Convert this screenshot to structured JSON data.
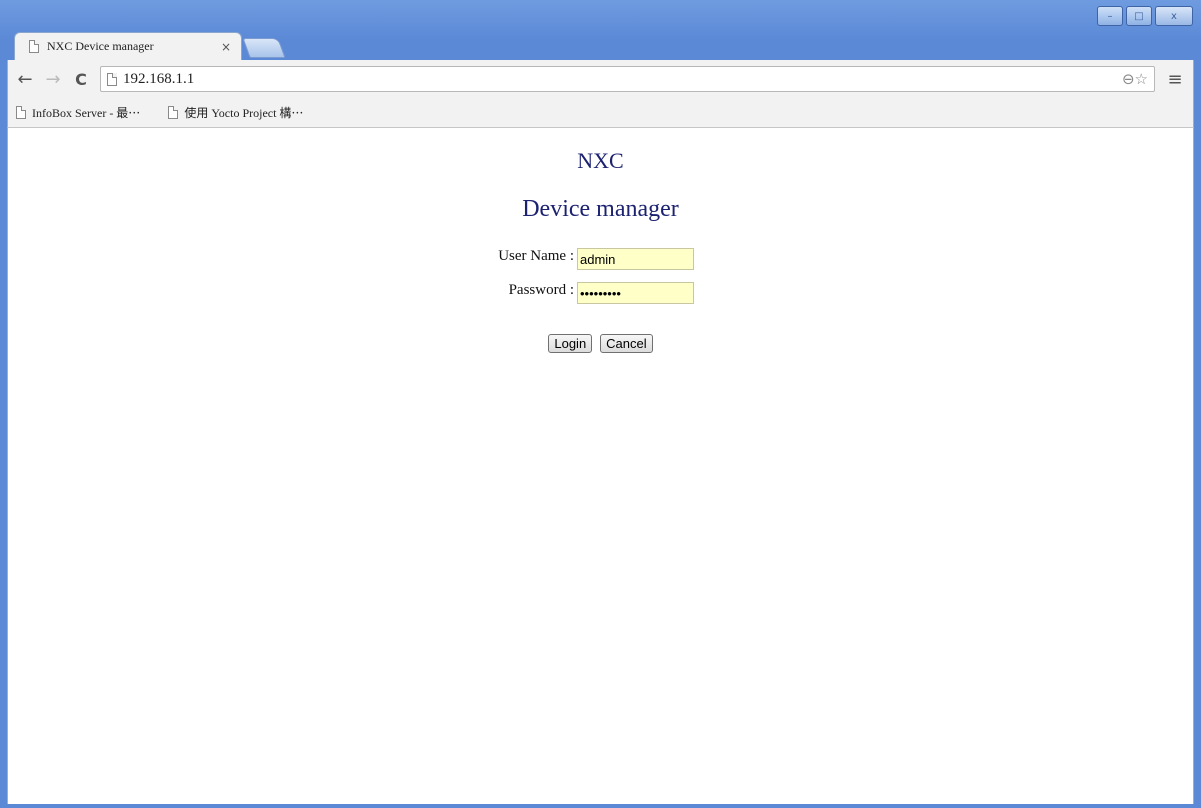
{
  "browser": {
    "tab": {
      "title": "NXC Device manager",
      "close": "×"
    },
    "window_controls": {
      "minimize": "–",
      "maximize": "□",
      "close": "x"
    },
    "nav": {
      "back": "←",
      "forward": "→",
      "reload": "C"
    },
    "address": {
      "url": "192.168.1.1"
    },
    "omnibox_icons": {
      "zoom": "⊖",
      "star": "☆"
    },
    "menu": "≡",
    "bookmarks": [
      {
        "label": "InfoBox Server - 最⋯"
      },
      {
        "label": "使用 Yocto Project 構⋯"
      }
    ]
  },
  "page": {
    "brand": "NXC",
    "heading": "Device manager",
    "form": {
      "username_label": "User Name :",
      "username_value": "admin",
      "password_label": "Password :",
      "password_value": "xxxxxxxxx"
    },
    "buttons": {
      "login": "Login",
      "cancel": "Cancel"
    }
  },
  "colors": {
    "heading": "#1c2270",
    "input_bg": "#ffffc8",
    "frame": "#5b89d6"
  }
}
